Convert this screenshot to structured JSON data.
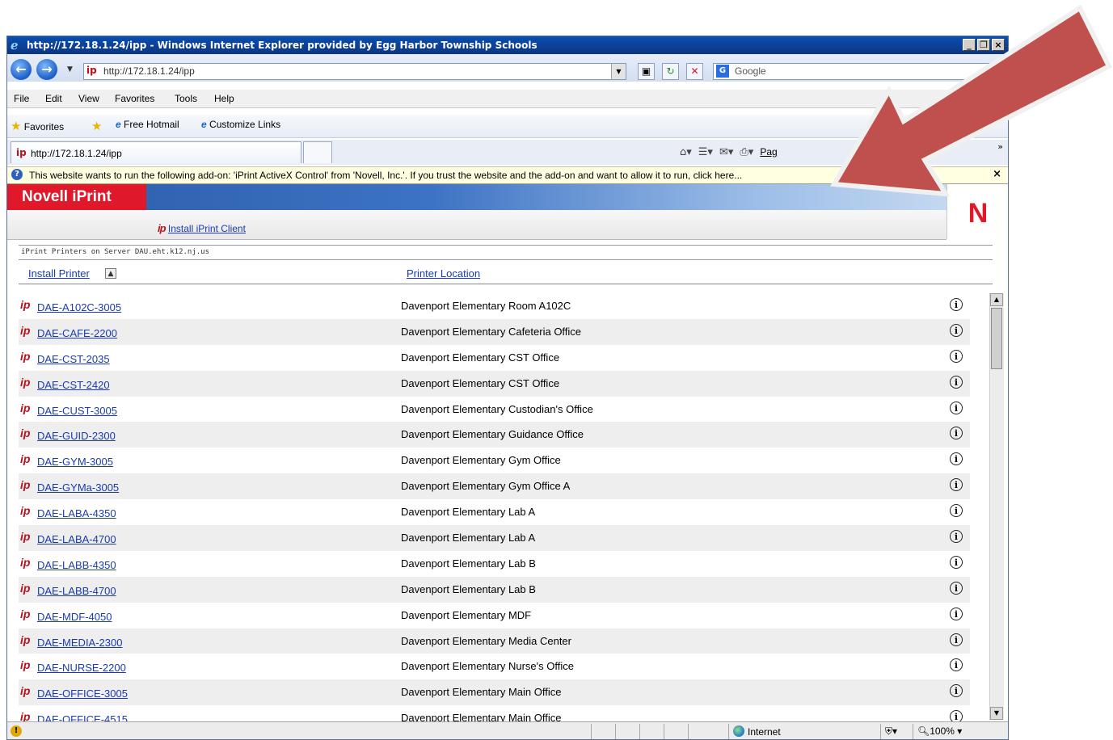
{
  "window": {
    "title": "http://172.18.1.24/ipp - Windows Internet Explorer provided by Egg Harbor Township Schools",
    "min_label": "_",
    "max_label": "❐",
    "close_label": "×"
  },
  "address_bar": {
    "url": "http://172.18.1.24/ipp",
    "search_placeholder": "Google"
  },
  "menu": [
    "File",
    "Edit",
    "View",
    "Favorites",
    "Tools",
    "Help"
  ],
  "favorites_bar": {
    "favorites_label": "Favorites",
    "links": [
      "Free Hotmail",
      "Customize Links"
    ]
  },
  "tab": {
    "label": "http://172.18.1.24/ipp"
  },
  "command_bar": {
    "page_label": "Pag"
  },
  "infobar": {
    "message": "This website wants to run the following add-on: 'iPrint ActiveX Control' from 'Novell, Inc.'. If you trust the website and the add-on and want to allow it to run, click here..."
  },
  "iprint": {
    "brand": "Novell iPrint",
    "logo_letter": "N",
    "install_client": "Install iPrint Client",
    "server_label": "iPrint Printers on Server DAU.eht.k12.nj.us",
    "col_install": "Install Printer",
    "col_location": "Printer Location"
  },
  "printers": [
    {
      "name": "DAE-A102C-3005",
      "location": "Davenport Elementary Room A102C"
    },
    {
      "name": "DAE-CAFE-2200",
      "location": "Davenport Elementary Cafeteria Office"
    },
    {
      "name": "DAE-CST-2035",
      "location": "Davenport Elementary CST Office"
    },
    {
      "name": "DAE-CST-2420",
      "location": "Davenport Elementary CST Office"
    },
    {
      "name": "DAE-CUST-3005",
      "location": "Davenport Elementary Custodian's Office"
    },
    {
      "name": "DAE-GUID-2300",
      "location": "Davenport Elementary Guidance Office"
    },
    {
      "name": "DAE-GYM-3005",
      "location": "Davenport Elementary Gym Office"
    },
    {
      "name": "DAE-GYMa-3005",
      "location": "Davenport Elementary Gym Office A"
    },
    {
      "name": "DAE-LABA-4350",
      "location": "Davenport Elementary Lab A"
    },
    {
      "name": "DAE-LABA-4700",
      "location": "Davenport Elementary Lab A"
    },
    {
      "name": "DAE-LABB-4350",
      "location": "Davenport Elementary Lab B"
    },
    {
      "name": "DAE-LABB-4700",
      "location": "Davenport Elementary Lab B"
    },
    {
      "name": "DAE-MDF-4050",
      "location": "Davenport Elementary MDF"
    },
    {
      "name": "DAE-MEDIA-2300",
      "location": "Davenport Elementary Media Center"
    },
    {
      "name": "DAE-NURSE-2200",
      "location": "Davenport Elementary Nurse's Office"
    },
    {
      "name": "DAE-OFFICE-3005",
      "location": "Davenport Elementary Main Office"
    },
    {
      "name": "DAE-OFFICE-4515",
      "location": "Davenport Elementary Main Office"
    }
  ],
  "statusbar": {
    "zone": "Internet",
    "zoom": "100%"
  },
  "colors": {
    "novell_red": "#e0192a",
    "annotation_arrow": "#c0504d",
    "link_blue": "#1a3bb0"
  }
}
